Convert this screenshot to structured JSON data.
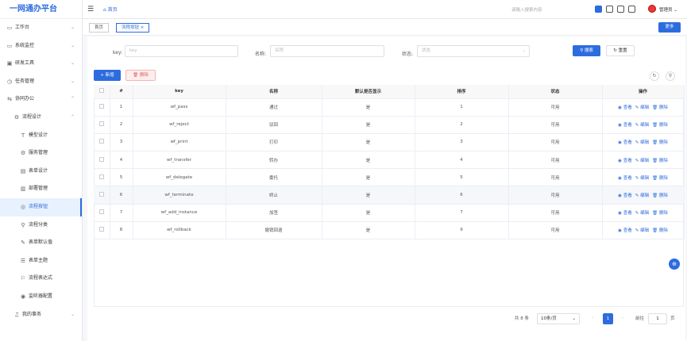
{
  "app": {
    "title": "一网通办平台"
  },
  "sidebar": {
    "items": [
      {
        "label": "工作台",
        "icon": "monitor-icon",
        "glyph": "▭",
        "chev": "⌄",
        "level": "lv1"
      },
      {
        "label": "系统监控",
        "icon": "monitor-icon",
        "glyph": "▭",
        "chev": "⌄",
        "level": "lv1"
      },
      {
        "label": "研发工具",
        "icon": "tool-icon",
        "glyph": "▣",
        "chev": "⌄",
        "level": "lv1"
      },
      {
        "label": "任务管理",
        "icon": "task-icon",
        "glyph": "◷",
        "chev": "⌄",
        "level": "lv1"
      },
      {
        "label": "协同办公",
        "icon": "collab-icon",
        "glyph": "⇆",
        "chev": "⌃",
        "level": "lv1"
      },
      {
        "label": "流程设计",
        "icon": "flow-icon",
        "glyph": "⚙",
        "chev": "⌃",
        "level": "lv2"
      },
      {
        "label": "模型设计",
        "icon": "model-icon",
        "glyph": "T",
        "chev": "",
        "level": "lv3"
      },
      {
        "label": "服务管理",
        "icon": "service-icon",
        "glyph": "⚙",
        "chev": "",
        "level": "lv3"
      },
      {
        "label": "表单设计",
        "icon": "form-icon",
        "glyph": "▤",
        "chev": "",
        "level": "lv3"
      },
      {
        "label": "部署管理",
        "icon": "deploy-icon",
        "glyph": "▥",
        "chev": "",
        "level": "lv3"
      },
      {
        "label": "流程按钮",
        "icon": "button-icon",
        "glyph": "◎",
        "chev": "",
        "level": "lv3",
        "active": true
      },
      {
        "label": "流程分类",
        "icon": "category-icon",
        "glyph": "⚲",
        "chev": "",
        "level": "lv3"
      },
      {
        "label": "表单默认值",
        "icon": "default-icon",
        "glyph": "✎",
        "chev": "",
        "level": "lv3"
      },
      {
        "label": "表单主题",
        "icon": "theme-icon",
        "glyph": "☰",
        "chev": "",
        "level": "lv3"
      },
      {
        "label": "流程表达式",
        "icon": "expression-icon",
        "glyph": "⚐",
        "chev": "",
        "level": "lv3"
      },
      {
        "label": "监听器配置",
        "icon": "listener-icon",
        "glyph": "◉",
        "chev": "",
        "level": "lv3"
      },
      {
        "label": "我的事务",
        "icon": "bell-icon",
        "glyph": "♫",
        "chev": "⌄",
        "level": "lv2"
      }
    ]
  },
  "header": {
    "home": "首页",
    "search_placeholder": "请输入搜索内容",
    "user": "管理员"
  },
  "tabs": {
    "home": "首页",
    "current": "流程按钮",
    "close": "×",
    "more": "更多"
  },
  "filters": {
    "key_label": "key:",
    "key_placeholder": "key",
    "name_label": "名称:",
    "name_placeholder": "名称",
    "status_label": "状态:",
    "status_placeholder": "状态",
    "status_arrow": "⌄",
    "search": "搜索",
    "reset": "重置"
  },
  "actions": {
    "add": "新增",
    "delete": "删除"
  },
  "table": {
    "headers": [
      "#",
      "key",
      "名称",
      "默认是否显示",
      "排序",
      "状态",
      "操作"
    ],
    "rows": [
      {
        "n": "1",
        "key": "wf_pass",
        "name": "通过",
        "show": "是",
        "sort": "1",
        "status": "可用"
      },
      {
        "n": "2",
        "key": "wf_reject",
        "name": "驳回",
        "show": "是",
        "sort": "2",
        "status": "可用"
      },
      {
        "n": "3",
        "key": "wf_print",
        "name": "打印",
        "show": "是",
        "sort": "3",
        "status": "可用"
      },
      {
        "n": "4",
        "key": "wf_transfer",
        "name": "转办",
        "show": "是",
        "sort": "4",
        "status": "可用"
      },
      {
        "n": "5",
        "key": "wf_delegate",
        "name": "委托",
        "show": "是",
        "sort": "5",
        "status": "可用"
      },
      {
        "n": "6",
        "key": "wf_terminate",
        "name": "终止",
        "show": "是",
        "sort": "6",
        "status": "可用"
      },
      {
        "n": "7",
        "key": "wf_add_instance",
        "name": "加签",
        "show": "是",
        "sort": "7",
        "status": "可用"
      },
      {
        "n": "8",
        "key": "wf_rollback",
        "name": "撤销回退",
        "show": "是",
        "sort": "9",
        "status": "可用"
      }
    ],
    "ops": {
      "view": "查看",
      "edit": "编辑",
      "del": "删除"
    }
  },
  "pagination": {
    "total": "共 8 条",
    "page_size": "10条/页",
    "page": "1",
    "goto": "前往",
    "goto_value": "1",
    "unit": "页"
  },
  "colors": {
    "accent": "#2d6cdf",
    "danger": "#e25b5b"
  }
}
